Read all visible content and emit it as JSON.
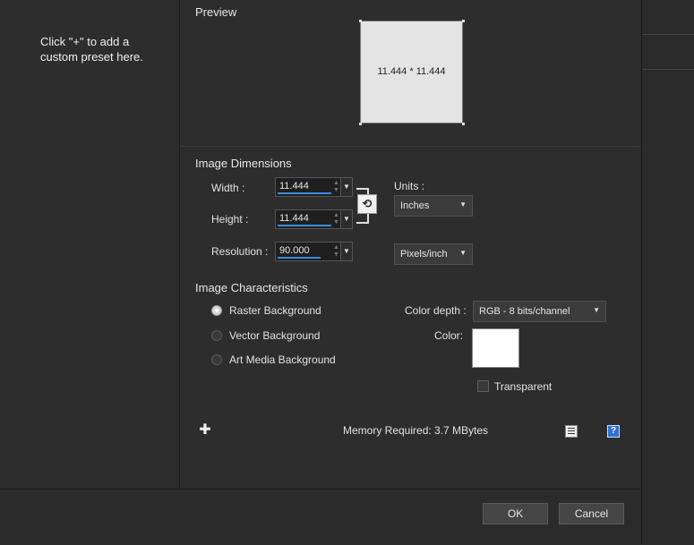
{
  "presets": {
    "hint": "Click \"+\" to add a\ncustom preset here."
  },
  "preview": {
    "label": "Preview",
    "dimensions_text": "11.444 * 11.444"
  },
  "dimensions": {
    "section_label": "Image Dimensions",
    "width_label": "Width :",
    "width_value": "11.444",
    "height_label": "Height :",
    "height_value": "11.444",
    "resolution_label": "Resolution :",
    "resolution_value": "90.000",
    "units_label": "Units :",
    "units_value": "Inches",
    "resolution_units_value": "Pixels/inch"
  },
  "characteristics": {
    "section_label": "Image Characteristics",
    "options": [
      "Raster Background",
      "Vector Background",
      "Art Media Background"
    ],
    "selected": "Raster Background",
    "color_depth_label": "Color depth :",
    "color_depth_value": "RGB - 8 bits/channel",
    "color_label": "Color:",
    "color_swatch": "#ffffff",
    "transparent_label": "Transparent",
    "transparent_checked": false
  },
  "memory": {
    "label": "Memory Required:",
    "value": "3.7 MBytes"
  },
  "icons": {
    "add": "plus-icon",
    "memory": "memory-info-icon",
    "help": "help-icon",
    "link": "chain-link-icon"
  },
  "buttons": {
    "ok": "OK",
    "cancel": "Cancel"
  },
  "colors": {
    "accent": "#3a8be0",
    "background": "#2d2d2d"
  }
}
